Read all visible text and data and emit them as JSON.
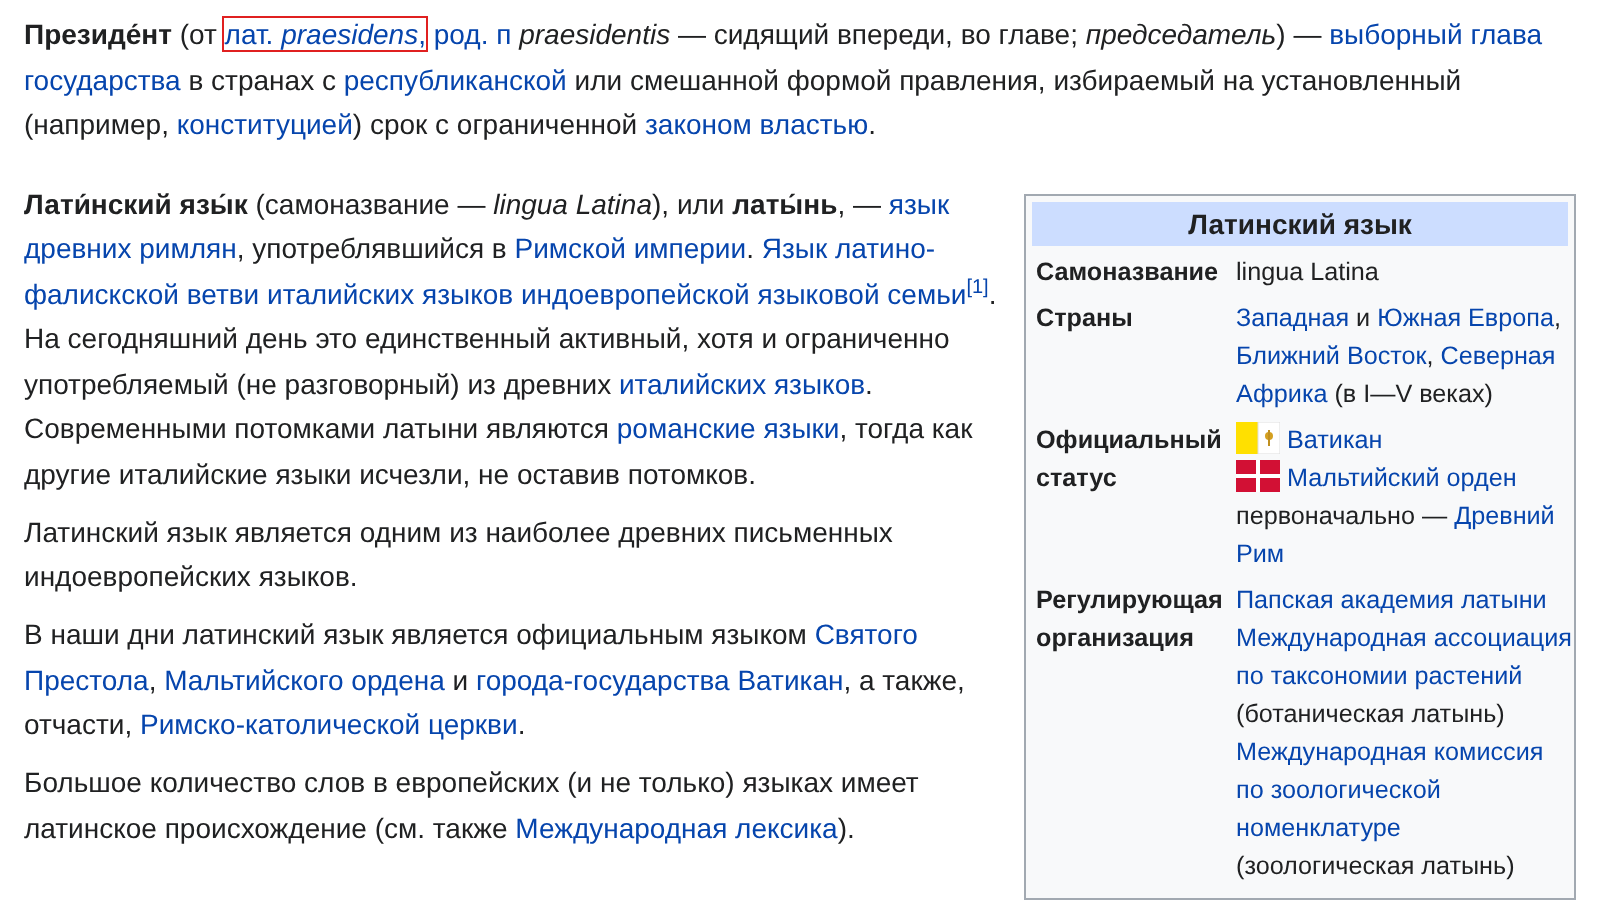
{
  "intro": {
    "lines": [
      [
        {
          "kind": "text",
          "text": "**Президе́нт** (от "
        },
        {
          "kind": "marked_link",
          "text": "лат. *praesidens*,"
        },
        {
          "kind": "gap"
        },
        {
          "kind": "link",
          "text": "род. п"
        },
        {
          "kind": "text",
          "text": " *praesidentis* — сидящий впереди, во главе; *председатель*) — "
        },
        {
          "kind": "link",
          "text": "выборный глава"
        }
      ],
      [
        {
          "kind": "link",
          "text": "государства"
        },
        {
          "kind": "text",
          "text": " в странах с "
        },
        {
          "kind": "link",
          "text": "республиканской"
        },
        {
          "kind": "text",
          "text": " или смешанной формой правления, избираемый на установленный"
        }
      ],
      [
        {
          "kind": "text",
          "text": "(например, "
        },
        {
          "kind": "link",
          "text": "конституцией"
        },
        {
          "kind": "text",
          "text": ") срок с ограниченной "
        },
        {
          "kind": "link",
          "text": "законом властью"
        },
        {
          "kind": "text",
          "text": "."
        }
      ]
    ]
  },
  "paragraphs": [
    {
      "lines": [
        [
          {
            "kind": "text",
            "text": "**Лати́нский язы́к** (самоназвание — *lingua Latina*), или **латы́нь**, — "
          },
          {
            "kind": "link",
            "text": "язык"
          }
        ],
        [
          {
            "kind": "link",
            "text": "древних римлян"
          },
          {
            "kind": "text",
            "text": ", употреблявшийся в "
          },
          {
            "kind": "link",
            "text": "Римской империи"
          },
          {
            "kind": "text",
            "text": ". "
          },
          {
            "kind": "link",
            "text": "Язык латино-"
          }
        ],
        [
          {
            "kind": "link",
            "text": "фалискской ветви италийских языков индоевропейской языковой семьи"
          },
          {
            "kind": "footnote",
            "text": "[1]"
          },
          {
            "kind": "text",
            "text": "."
          }
        ],
        [
          {
            "kind": "text",
            "text": "На сегодняшний день это единственный активный, хотя и ограниченно"
          }
        ],
        [
          {
            "kind": "text",
            "text": "употребляемый (не разговорный) из древних "
          },
          {
            "kind": "link",
            "text": "италийских языков"
          },
          {
            "kind": "text",
            "text": "."
          }
        ],
        [
          {
            "kind": "text",
            "text": "Современными потомками латыни являются "
          },
          {
            "kind": "link",
            "text": "романские языки"
          },
          {
            "kind": "text",
            "text": ", тогда как"
          }
        ],
        [
          {
            "kind": "text",
            "text": "другие италийские языки исчезли, не оставив потомков."
          }
        ]
      ]
    },
    {
      "lines": [
        [
          {
            "kind": "text",
            "text": "Латинский язык является одним из наиболее древних письменных"
          }
        ],
        [
          {
            "kind": "text",
            "text": "индоевропейских языков."
          }
        ]
      ]
    },
    {
      "lines": [
        [
          {
            "kind": "text",
            "text": "В наши дни латинский язык является официальным языком "
          },
          {
            "kind": "link",
            "text": "Святого"
          }
        ],
        [
          {
            "kind": "link",
            "text": "Престола"
          },
          {
            "kind": "text",
            "text": ", "
          },
          {
            "kind": "link",
            "text": "Мальтийского ордена"
          },
          {
            "kind": "text",
            "text": " и "
          },
          {
            "kind": "link",
            "text": "города-государства Ватикан"
          },
          {
            "kind": "text",
            "text": ", а также,"
          }
        ],
        [
          {
            "kind": "text",
            "text": "отчасти, "
          },
          {
            "kind": "link",
            "text": "Римско-католической церкви"
          },
          {
            "kind": "text",
            "text": "."
          }
        ]
      ]
    },
    {
      "lines": [
        [
          {
            "kind": "text",
            "text": "Большое количество слов в европейских (и не только) языках имеет"
          }
        ],
        [
          {
            "kind": "text",
            "text": "латинское происхождение (см. также "
          },
          {
            "kind": "link",
            "text": "Международная лексика"
          },
          {
            "kind": "text",
            "text": ")."
          }
        ]
      ]
    }
  ],
  "infobox": {
    "title": "Латинский язык",
    "rows": [
      {
        "label": "Самоназвание",
        "lines": [
          [
            {
              "kind": "text",
              "text": "lingua Latina"
            }
          ]
        ]
      },
      {
        "label": "Страны",
        "lines": [
          [
            {
              "kind": "link",
              "text": "Западная"
            },
            {
              "kind": "text",
              "text": " и "
            },
            {
              "kind": "link",
              "text": "Южная Европа"
            },
            {
              "kind": "text",
              "text": ","
            }
          ],
          [
            {
              "kind": "link",
              "text": "Ближний Восток"
            },
            {
              "kind": "text",
              "text": ", "
            },
            {
              "kind": "link",
              "text": "Северная"
            }
          ],
          [
            {
              "kind": "link",
              "text": "Африка"
            },
            {
              "kind": "text",
              "text": " (в I—V веках)"
            }
          ]
        ]
      },
      {
        "label": "Официальный статус",
        "lines": [
          [
            {
              "kind": "flag"
            },
            {
              "kind": "gap"
            },
            {
              "kind": "link",
              "text": "Ватикан"
            }
          ],
          [
            {
              "kind": "flag"
            },
            {
              "kind": "gap"
            },
            {
              "kind": "link",
              "text": "Мальтийский орден"
            }
          ],
          [
            {
              "kind": "text",
              "text": "первоначально — "
            },
            {
              "kind": "link",
              "text": "Древний"
            }
          ],
          [
            {
              "kind": "link",
              "text": "Рим"
            }
          ]
        ]
      },
      {
        "label": "Регулирующая организация",
        "lines": [
          [
            {
              "kind": "link",
              "text": "Папская академия латыни"
            }
          ],
          [
            {
              "kind": "link",
              "text": "Международная ассоциация"
            }
          ],
          [
            {
              "kind": "link",
              "text": "по таксономии растений"
            }
          ],
          [
            {
              "kind": "text",
              "text": "(ботаническая латынь)"
            }
          ],
          [
            {
              "kind": "link",
              "text": "Международная комиссия"
            }
          ],
          [
            {
              "kind": "link",
              "text": "по зоологической"
            }
          ],
          [
            {
              "kind": "link",
              "text": "номенклатуре"
            }
          ],
          [
            {
              "kind": "text",
              "text": "(зоологическая латынь)"
            }
          ]
        ]
      }
    ]
  }
}
